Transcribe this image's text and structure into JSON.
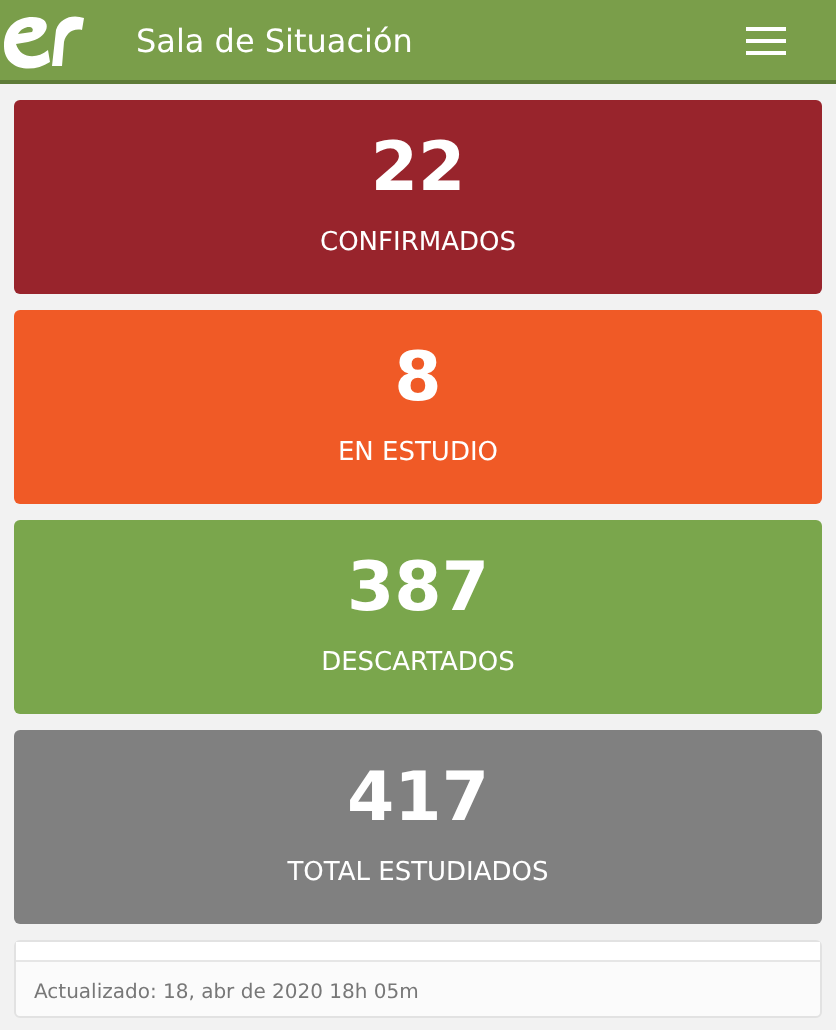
{
  "header": {
    "title": "Sala de Situación"
  },
  "stats": [
    {
      "value": "22",
      "label": "CONFIRMADOS",
      "color": "#98242c"
    },
    {
      "value": "8",
      "label": "EN ESTUDIO",
      "color": "#f05a26"
    },
    {
      "value": "387",
      "label": "DESCARTADOS",
      "color": "#7aa64c"
    },
    {
      "value": "417",
      "label": "TOTAL ESTUDIADOS",
      "color": "#808080"
    }
  ],
  "footer": {
    "updated": "Actualizado: 18, abr de 2020 18h 05m"
  }
}
